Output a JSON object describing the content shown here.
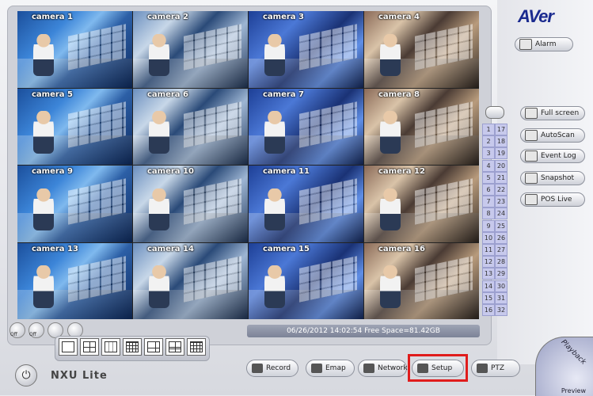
{
  "app": {
    "logo": "AVer",
    "product_name": "NXU Lite"
  },
  "alarm_label": "Alarm",
  "cameras": [
    "camera 1",
    "camera 2",
    "camera 3",
    "camera 4",
    "camera 5",
    "camera 6",
    "camera 7",
    "camera 8",
    "camera 9",
    "camera 10",
    "camera 11",
    "camera 12",
    "camera 13",
    "camera 14",
    "camera 15",
    "camera 16"
  ],
  "channel_numbers_left": [
    "1",
    "2",
    "3",
    "4",
    "5",
    "6",
    "7",
    "8",
    "9",
    "10",
    "11",
    "12",
    "13",
    "14",
    "15",
    "16"
  ],
  "channel_numbers_right": [
    "17",
    "18",
    "19",
    "20",
    "21",
    "22",
    "23",
    "24",
    "25",
    "26",
    "27",
    "28",
    "29",
    "30",
    "31",
    "32"
  ],
  "status_text": "06/26/2012 14:02:54  Free Space=81.42GB",
  "side_buttons": [
    "Full screen",
    "AutoScan",
    "Event Log",
    "Snapshot",
    "POS Live"
  ],
  "bottom_buttons": [
    "Record",
    "Emap",
    "Network",
    "Setup",
    "PTZ"
  ],
  "small_icons": [
    "Off",
    "Off"
  ],
  "playback": {
    "label_top": "Playback",
    "label_bottom": "Preview"
  },
  "colors": {
    "highlight": "#e01c1c",
    "accent": "#1a2a8f"
  }
}
